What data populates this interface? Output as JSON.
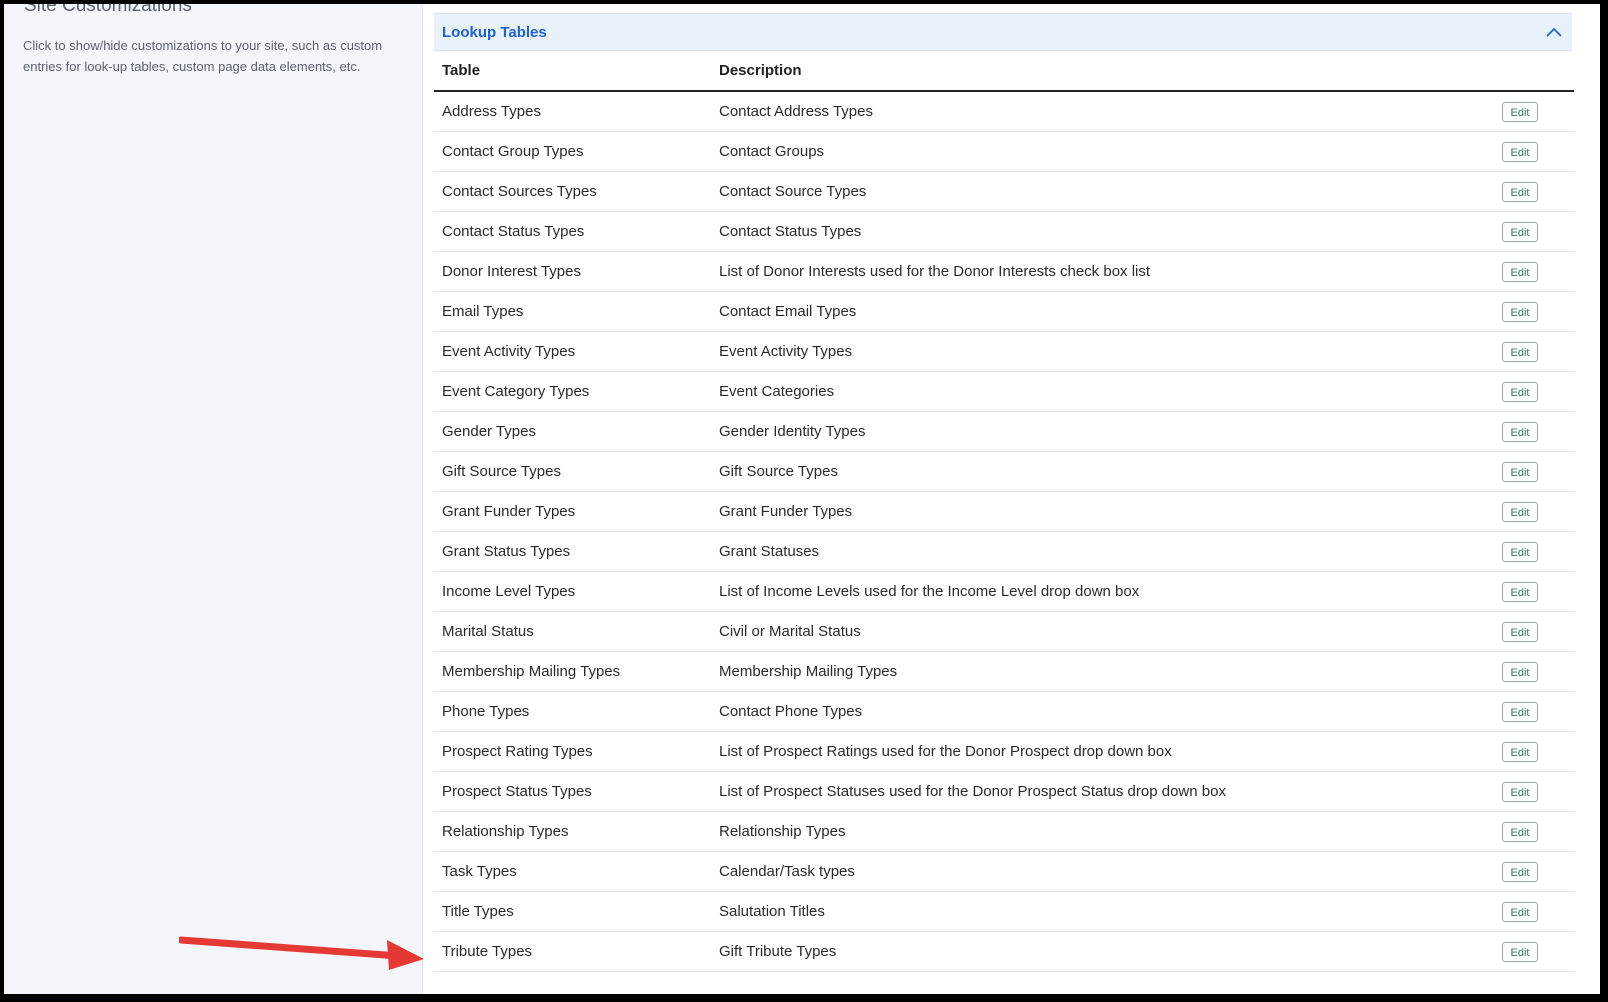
{
  "sidebar": {
    "title": "Site Customizations",
    "description": "Click to show/hide customizations to your site, such as custom entries for look-up tables, custom page data elements, etc."
  },
  "section": {
    "title": "Lookup Tables",
    "collapse_icon": "chevron-up-icon"
  },
  "table": {
    "columns": [
      "Table",
      "Description"
    ],
    "edit_label": "Edit",
    "rows": [
      {
        "table": "Address Types",
        "description": "Contact Address Types"
      },
      {
        "table": "Contact Group Types",
        "description": "Contact Groups"
      },
      {
        "table": "Contact Sources Types",
        "description": "Contact Source Types"
      },
      {
        "table": "Contact Status Types",
        "description": "Contact Status Types"
      },
      {
        "table": "Donor Interest Types",
        "description": "List of Donor Interests used for the Donor Interests check box list"
      },
      {
        "table": "Email Types",
        "description": "Contact Email Types"
      },
      {
        "table": "Event Activity Types",
        "description": "Event Activity Types"
      },
      {
        "table": "Event Category Types",
        "description": "Event Categories"
      },
      {
        "table": "Gender Types",
        "description": "Gender Identity Types"
      },
      {
        "table": "Gift Source Types",
        "description": "Gift Source Types"
      },
      {
        "table": "Grant Funder Types",
        "description": "Grant Funder Types"
      },
      {
        "table": "Grant Status Types",
        "description": "Grant Statuses"
      },
      {
        "table": "Income Level Types",
        "description": "List of Income Levels used for the Income Level drop down box"
      },
      {
        "table": "Marital Status",
        "description": "Civil or Marital Status"
      },
      {
        "table": "Membership Mailing Types",
        "description": "Membership Mailing Types"
      },
      {
        "table": "Phone Types",
        "description": "Contact Phone Types"
      },
      {
        "table": "Prospect Rating Types",
        "description": "List of Prospect Ratings used for the Donor Prospect drop down box"
      },
      {
        "table": "Prospect Status Types",
        "description": "List of Prospect Statuses used for the Donor Prospect Status drop down box"
      },
      {
        "table": "Relationship Types",
        "description": "Relationship Types"
      },
      {
        "table": "Task Types",
        "description": "Calendar/Task types"
      },
      {
        "table": "Title Types",
        "description": "Salutation Titles"
      },
      {
        "table": "Tribute Types",
        "description": "Gift Tribute Types"
      }
    ]
  },
  "colors": {
    "accent": "#1d63c8",
    "edit_text": "#2e7d4f",
    "annotation_arrow": "#e53935"
  }
}
